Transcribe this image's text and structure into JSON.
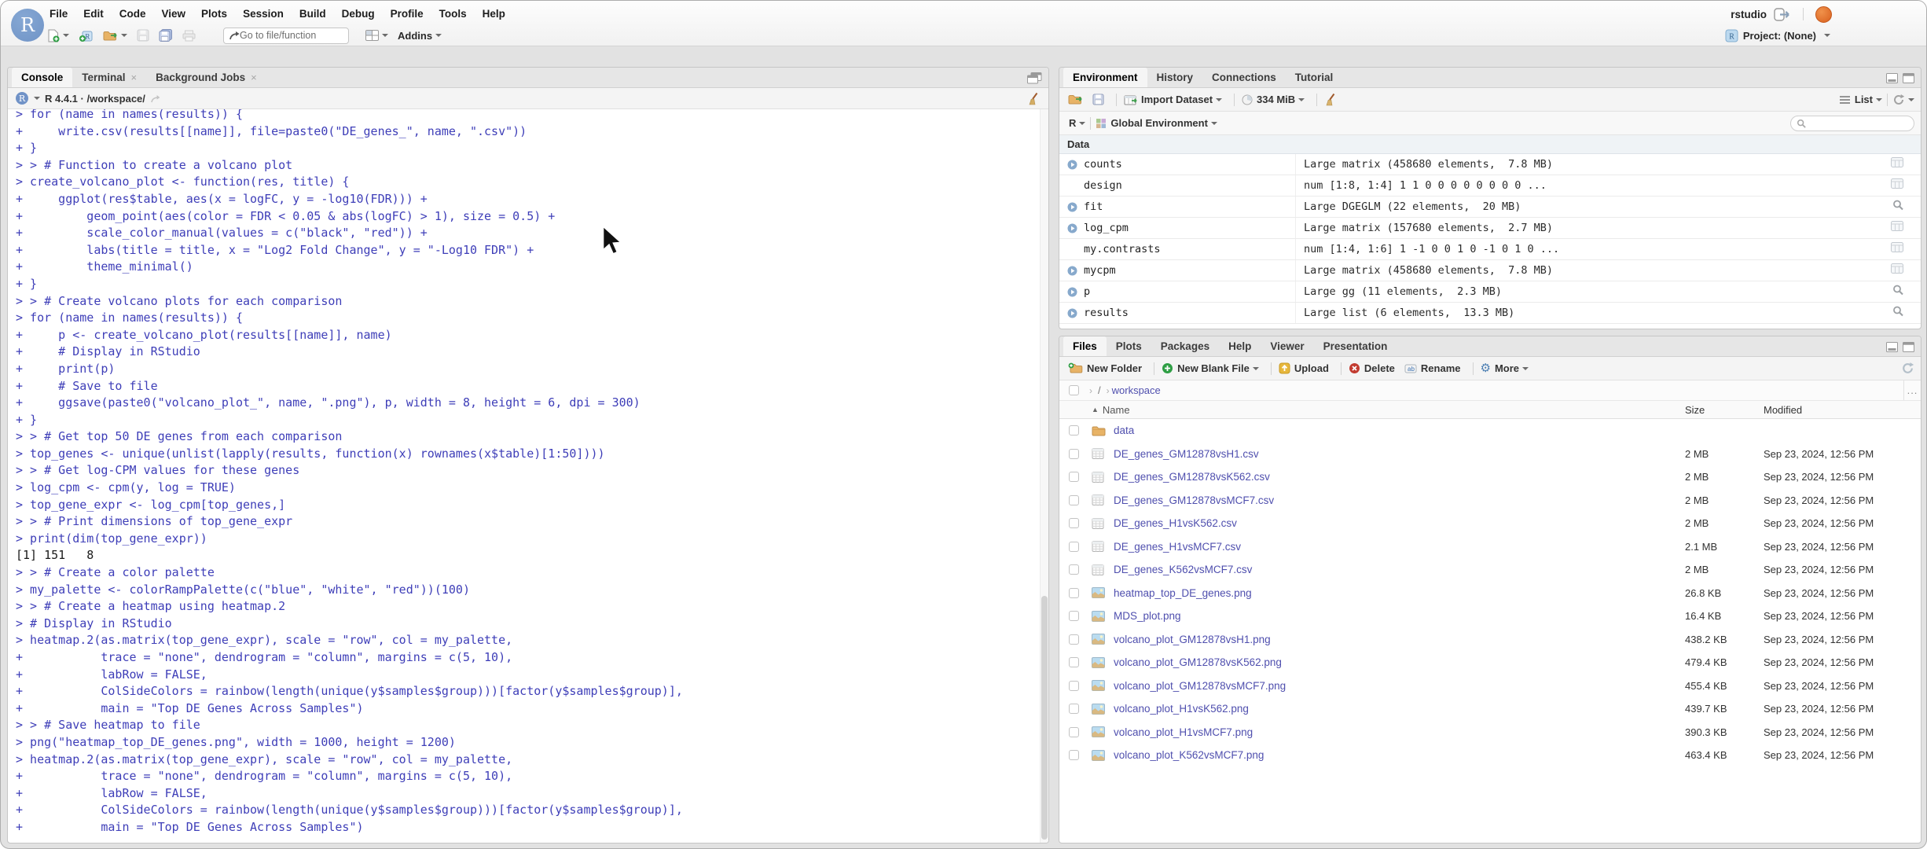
{
  "window": {
    "account_label": "rstudio",
    "project_label": "Project: (None)"
  },
  "menu": {
    "items": [
      "File",
      "Edit",
      "Code",
      "View",
      "Plots",
      "Session",
      "Build",
      "Debug",
      "Profile",
      "Tools",
      "Help"
    ]
  },
  "toolbar": {
    "goto_placeholder": "Go to file/function",
    "addins_label": "Addins"
  },
  "console": {
    "tabs": [
      {
        "label": "Console",
        "active": true,
        "closable": false
      },
      {
        "label": "Terminal",
        "active": false,
        "closable": true
      },
      {
        "label": "Background Jobs",
        "active": false,
        "closable": true
      }
    ],
    "r_version": "R 4.4.1 · /workspace/",
    "lines": [
      {
        "type": "input",
        "text": "> for (name in names(results)) {"
      },
      {
        "type": "input",
        "text": "+     write.csv(results[[name]], file=paste0(\"DE_genes_\", name, \".csv\"))"
      },
      {
        "type": "input",
        "text": "+ }"
      },
      {
        "type": "input",
        "text": "> > # Function to create a volcano plot"
      },
      {
        "type": "input",
        "text": "> create_volcano_plot <- function(res, title) {"
      },
      {
        "type": "input",
        "text": "+     ggplot(res$table, aes(x = logFC, y = -log10(FDR))) +"
      },
      {
        "type": "input",
        "text": "+         geom_point(aes(color = FDR < 0.05 & abs(logFC) > 1), size = 0.5) +"
      },
      {
        "type": "input",
        "text": "+         scale_color_manual(values = c(\"black\", \"red\")) +"
      },
      {
        "type": "input",
        "text": "+         labs(title = title, x = \"Log2 Fold Change\", y = \"-Log10 FDR\") +"
      },
      {
        "type": "input",
        "text": "+         theme_minimal()"
      },
      {
        "type": "input",
        "text": "+ }"
      },
      {
        "type": "input",
        "text": "> > # Create volcano plots for each comparison"
      },
      {
        "type": "input",
        "text": "> for (name in names(results)) {"
      },
      {
        "type": "input",
        "text": "+     p <- create_volcano_plot(results[[name]], name)"
      },
      {
        "type": "input",
        "text": "+     # Display in RStudio"
      },
      {
        "type": "input",
        "text": "+     print(p)"
      },
      {
        "type": "input",
        "text": "+     # Save to file"
      },
      {
        "type": "input",
        "text": "+     ggsave(paste0(\"volcano_plot_\", name, \".png\"), p, width = 8, height = 6, dpi = 300)"
      },
      {
        "type": "input",
        "text": "+ }"
      },
      {
        "type": "input",
        "text": "> > # Get top 50 DE genes from each comparison"
      },
      {
        "type": "input",
        "text": "> top_genes <- unique(unlist(lapply(results, function(x) rownames(x$table)[1:50])))"
      },
      {
        "type": "input",
        "text": "> > # Get log-CPM values for these genes"
      },
      {
        "type": "input",
        "text": "> log_cpm <- cpm(y, log = TRUE)"
      },
      {
        "type": "input",
        "text": "> top_gene_expr <- log_cpm[top_genes,]"
      },
      {
        "type": "input",
        "text": "> > # Print dimensions of top_gene_expr"
      },
      {
        "type": "input",
        "text": "> print(dim(top_gene_expr))"
      },
      {
        "type": "output",
        "text": "[1] 151   8"
      },
      {
        "type": "input",
        "text": "> > # Create a color palette"
      },
      {
        "type": "input",
        "text": "> my_palette <- colorRampPalette(c(\"blue\", \"white\", \"red\"))(100)"
      },
      {
        "type": "input",
        "text": "> > # Create a heatmap using heatmap.2"
      },
      {
        "type": "input",
        "text": "> # Display in RStudio"
      },
      {
        "type": "input",
        "text": "> heatmap.2(as.matrix(top_gene_expr), scale = \"row\", col = my_palette,"
      },
      {
        "type": "input",
        "text": "+           trace = \"none\", dendrogram = \"column\", margins = c(5, 10),"
      },
      {
        "type": "input",
        "text": "+           labRow = FALSE,"
      },
      {
        "type": "input",
        "text": "+           ColSideColors = rainbow(length(unique(y$samples$group)))[factor(y$samples$group)],"
      },
      {
        "type": "input",
        "text": "+           main = \"Top DE Genes Across Samples\")"
      },
      {
        "type": "input",
        "text": "> > # Save heatmap to file"
      },
      {
        "type": "input",
        "text": "> png(\"heatmap_top_DE_genes.png\", width = 1000, height = 1200)"
      },
      {
        "type": "input",
        "text": "> heatmap.2(as.matrix(top_gene_expr), scale = \"row\", col = my_palette,"
      },
      {
        "type": "input",
        "text": "+           trace = \"none\", dendrogram = \"column\", margins = c(5, 10),"
      },
      {
        "type": "input",
        "text": "+           labRow = FALSE,"
      },
      {
        "type": "input",
        "text": "+           ColSideColors = rainbow(length(unique(y$samples$group)))[factor(y$samples$group)],"
      },
      {
        "type": "input",
        "text": "+           main = \"Top DE Genes Across Samples\")"
      }
    ]
  },
  "environment": {
    "tabs": [
      {
        "label": "Environment",
        "active": true
      },
      {
        "label": "History",
        "active": false
      },
      {
        "label": "Connections",
        "active": false
      },
      {
        "label": "Tutorial",
        "active": false
      }
    ],
    "toolbar": {
      "import_label": "Import Dataset",
      "memory_label": "334 MiB",
      "list_label": "List"
    },
    "scope": {
      "r_label": "R",
      "env_label": "Global Environment"
    },
    "section_label": "Data",
    "items": [
      {
        "name": "counts",
        "value": "Large matrix (458680 elements,  7.8 MB)",
        "expandable": true,
        "action": "grid"
      },
      {
        "name": "design",
        "value": "num [1:8, 1:4] 1 1 0 0 0 0 0 0 0 0 ...",
        "expandable": false,
        "action": "grid"
      },
      {
        "name": "fit",
        "value": "Large DGEGLM (22 elements,  20 MB)",
        "expandable": true,
        "action": "search"
      },
      {
        "name": "log_cpm",
        "value": "Large matrix (157680 elements,  2.7 MB)",
        "expandable": true,
        "action": "grid"
      },
      {
        "name": "my.contrasts",
        "value": "num [1:4, 1:6] 1 -1 0 0 1 0 -1 0 1 0 ...",
        "expandable": false,
        "action": "grid"
      },
      {
        "name": "mycpm",
        "value": "Large matrix (458680 elements,  7.8 MB)",
        "expandable": true,
        "action": "grid"
      },
      {
        "name": "p",
        "value": "Large gg (11 elements,  2.3 MB)",
        "expandable": true,
        "action": "search"
      },
      {
        "name": "results",
        "value": "Large list (6 elements,  13.3 MB)",
        "expandable": true,
        "action": "search"
      }
    ]
  },
  "files": {
    "tabs": [
      {
        "label": "Files",
        "active": true
      },
      {
        "label": "Plots",
        "active": false
      },
      {
        "label": "Packages",
        "active": false
      },
      {
        "label": "Help",
        "active": false
      },
      {
        "label": "Viewer",
        "active": false
      },
      {
        "label": "Presentation",
        "active": false
      }
    ],
    "toolbar": {
      "new_folder": "New Folder",
      "new_blank_file": "New Blank File",
      "upload": "Upload",
      "delete": "Delete",
      "rename": "Rename",
      "more": "More"
    },
    "breadcrumb": {
      "root": "/",
      "dir": "workspace",
      "more": "..."
    },
    "columns": {
      "name": "Name",
      "size": "Size",
      "modified": "Modified"
    },
    "rows": [
      {
        "name": "data",
        "type": "folder",
        "size": "",
        "modified": ""
      },
      {
        "name": "DE_genes_GM12878vsH1.csv",
        "type": "csv",
        "size": "2 MB",
        "modified": "Sep 23, 2024, 12:56 PM"
      },
      {
        "name": "DE_genes_GM12878vsK562.csv",
        "type": "csv",
        "size": "2 MB",
        "modified": "Sep 23, 2024, 12:56 PM"
      },
      {
        "name": "DE_genes_GM12878vsMCF7.csv",
        "type": "csv",
        "size": "2 MB",
        "modified": "Sep 23, 2024, 12:56 PM"
      },
      {
        "name": "DE_genes_H1vsK562.csv",
        "type": "csv",
        "size": "2 MB",
        "modified": "Sep 23, 2024, 12:56 PM"
      },
      {
        "name": "DE_genes_H1vsMCF7.csv",
        "type": "csv",
        "size": "2.1 MB",
        "modified": "Sep 23, 2024, 12:56 PM"
      },
      {
        "name": "DE_genes_K562vsMCF7.csv",
        "type": "csv",
        "size": "2 MB",
        "modified": "Sep 23, 2024, 12:56 PM"
      },
      {
        "name": "heatmap_top_DE_genes.png",
        "type": "image",
        "size": "26.8 KB",
        "modified": "Sep 23, 2024, 12:56 PM"
      },
      {
        "name": "MDS_plot.png",
        "type": "image",
        "size": "16.4 KB",
        "modified": "Sep 23, 2024, 12:56 PM"
      },
      {
        "name": "volcano_plot_GM12878vsH1.png",
        "type": "image",
        "size": "438.2 KB",
        "modified": "Sep 23, 2024, 12:56 PM"
      },
      {
        "name": "volcano_plot_GM12878vsK562.png",
        "type": "image",
        "size": "479.4 KB",
        "modified": "Sep 23, 2024, 12:56 PM"
      },
      {
        "name": "volcano_plot_GM12878vsMCF7.png",
        "type": "image",
        "size": "455.4 KB",
        "modified": "Sep 23, 2024, 12:56 PM"
      },
      {
        "name": "volcano_plot_H1vsK562.png",
        "type": "image",
        "size": "439.7 KB",
        "modified": "Sep 23, 2024, 12:56 PM"
      },
      {
        "name": "volcano_plot_H1vsMCF7.png",
        "type": "image",
        "size": "390.3 KB",
        "modified": "Sep 23, 2024, 12:56 PM"
      },
      {
        "name": "volcano_plot_K562vsMCF7.png",
        "type": "image",
        "size": "463.4 KB",
        "modified": "Sep 23, 2024, 12:56 PM"
      }
    ]
  },
  "colors": {
    "console_input": "#3e3eb8",
    "file_link": "#4f4fae",
    "logo_blue": "#7092c7",
    "accent_green": "#2e9e44",
    "delete_red": "#c23b30"
  }
}
